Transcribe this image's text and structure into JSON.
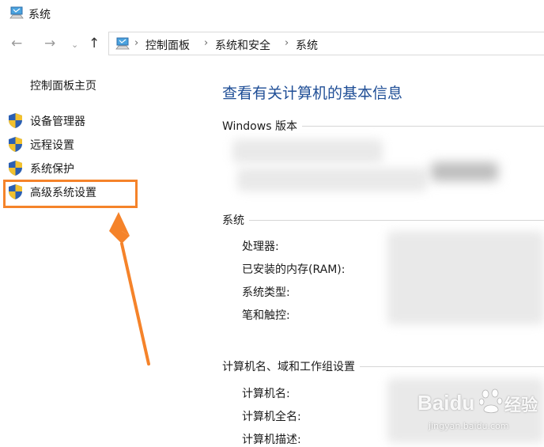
{
  "window": {
    "title": "系统"
  },
  "address": {
    "crumbs": [
      "控制面板",
      "系统和安全",
      "系统"
    ]
  },
  "nav": {
    "back": "←",
    "forward": "→",
    "recent": "⌄",
    "up": "↑",
    "separator": "›"
  },
  "sidebar": {
    "home": "控制面板主页",
    "items": [
      {
        "label": "设备管理器"
      },
      {
        "label": "远程设置"
      },
      {
        "label": "系统保护"
      },
      {
        "label": "高级系统设置"
      }
    ]
  },
  "main": {
    "heading": "查看有关计算机的基本信息",
    "sections": {
      "windows": {
        "title": "Windows 版本"
      },
      "system": {
        "title": "系统",
        "rows": [
          "处理器:",
          "已安装的内存(RAM):",
          "系统类型:",
          "笔和触控:"
        ]
      },
      "computer": {
        "title": "计算机名、域和工作组设置",
        "rows": [
          "计算机名:",
          "计算机全名:",
          "计算机描述:"
        ]
      }
    }
  },
  "watermark": {
    "brand": "Baidu",
    "suffix": "经验",
    "url": "jingyan.baidu.com"
  },
  "colors": {
    "heading": "#1f4e96",
    "highlight": "#f5832a"
  }
}
